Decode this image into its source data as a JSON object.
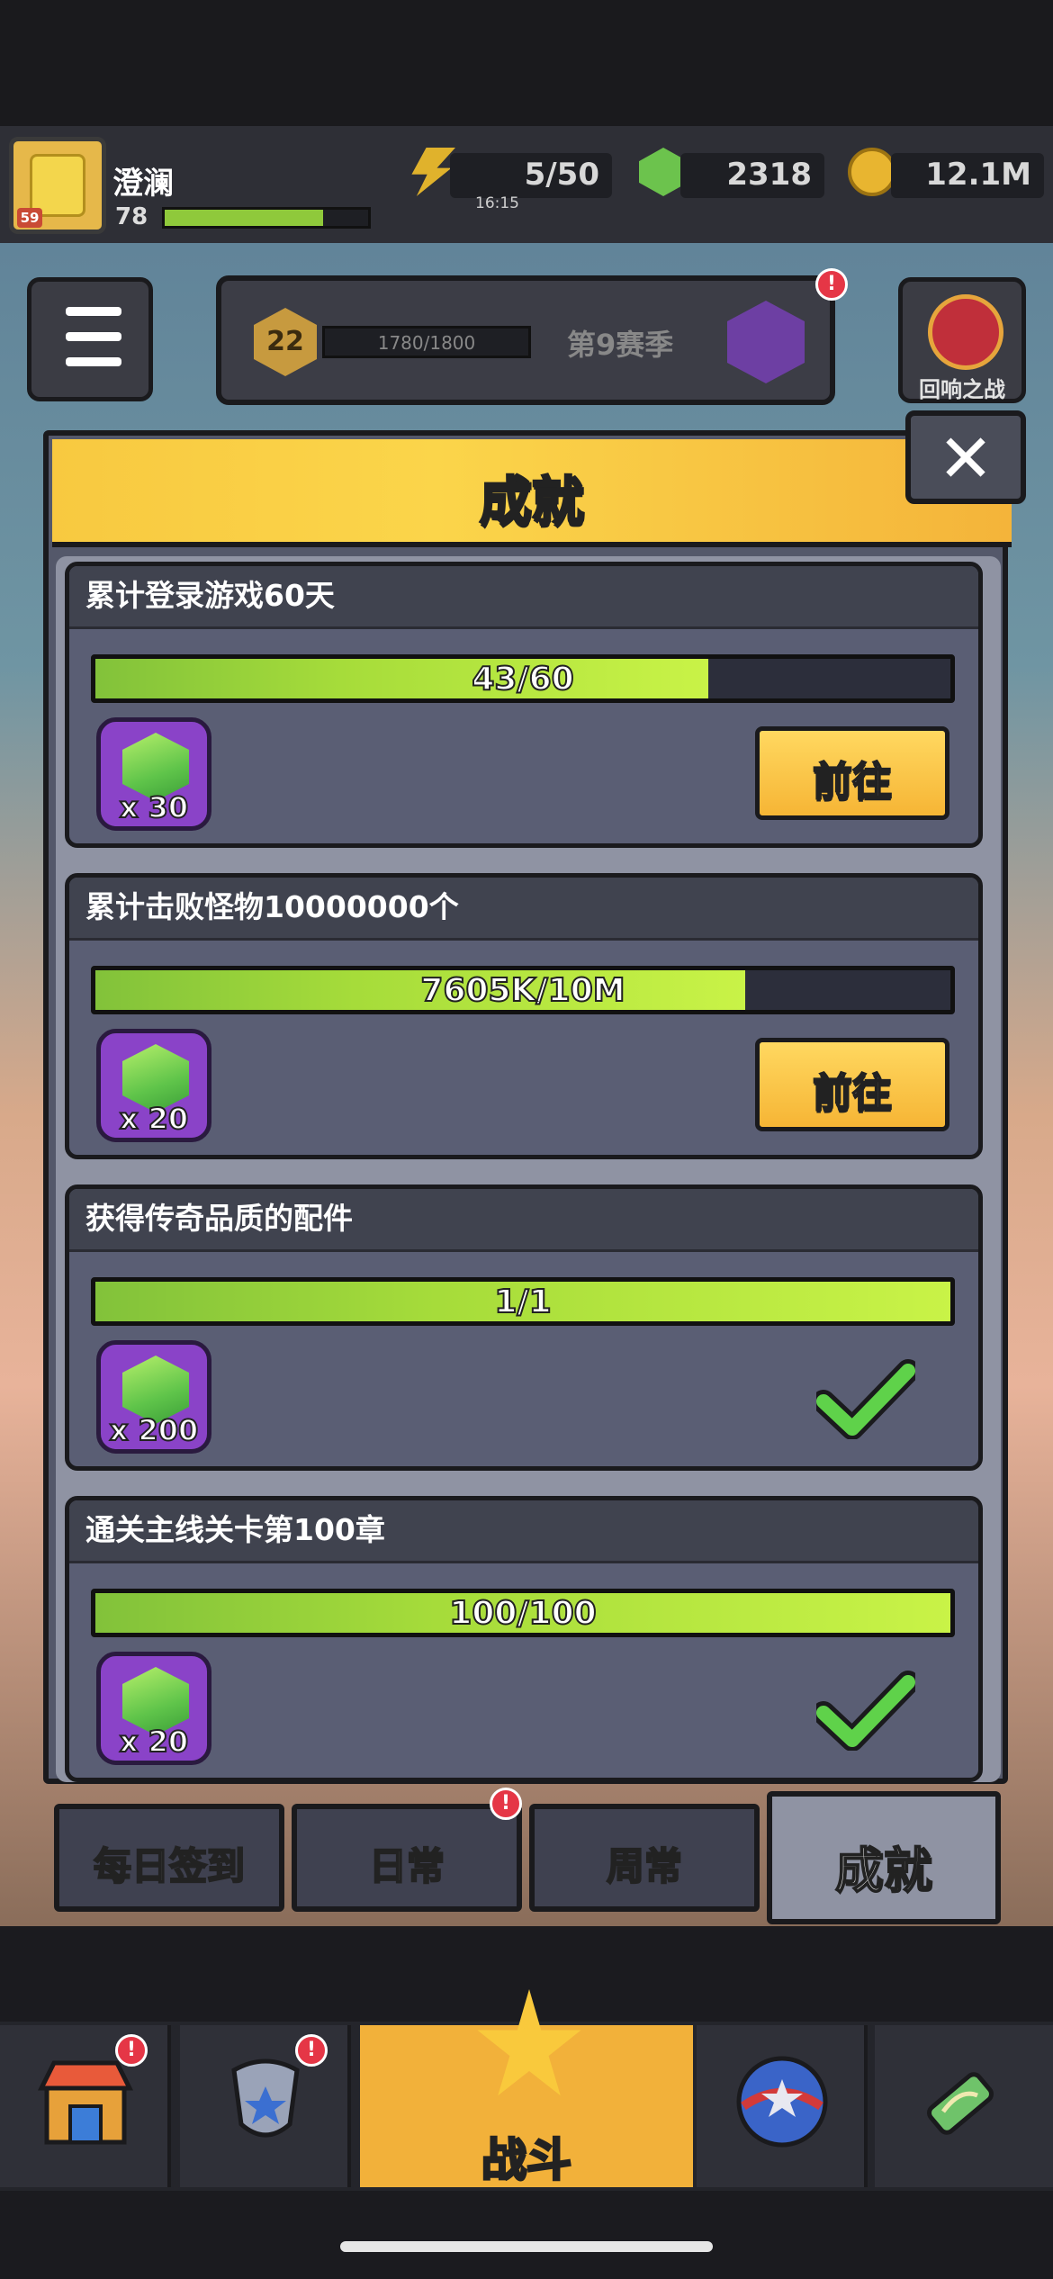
{
  "hud": {
    "player_name": "澄澜",
    "player_level": "78",
    "avatar_level": "59",
    "xp_fill_fraction": 0.78,
    "energy": "5/50",
    "energy_timer": "16:15",
    "gems": "2318",
    "coins": "12.1M"
  },
  "season": {
    "level": "22",
    "progress_text": "1780/1800",
    "label": "第9赛季",
    "alert": "!"
  },
  "echo_battle": {
    "label": "回响之战"
  },
  "modal": {
    "title": "成就",
    "close_glyph": "✕"
  },
  "achievements": [
    {
      "title": "累计登录游戏60天",
      "progress_text": "43/60",
      "progress_fraction": 0.717,
      "reward_qty": "x 30",
      "action": "前往",
      "completed": false
    },
    {
      "title": "累计击败怪物10000000个",
      "progress_text": "7605K/10M",
      "progress_fraction": 0.7605,
      "reward_qty": "x 20",
      "action": "前往",
      "completed": false
    },
    {
      "title": "获得传奇品质的配件",
      "progress_text": "1/1",
      "progress_fraction": 1.0,
      "reward_qty": "x 200",
      "action": "",
      "completed": true
    },
    {
      "title": "通关主线关卡第100章",
      "progress_text": "100/100",
      "progress_fraction": 1.0,
      "reward_qty": "x 20",
      "action": "",
      "completed": true
    }
  ],
  "tabs": [
    {
      "label": "每日签到",
      "active": false,
      "alert": ""
    },
    {
      "label": "日常",
      "active": false,
      "alert": "!"
    },
    {
      "label": "周常",
      "active": false,
      "alert": ""
    },
    {
      "label": "成就",
      "active": true,
      "alert": ""
    }
  ],
  "bottom_nav": {
    "battle_label": "战斗",
    "shop_alert": "!",
    "equip_alert": "!",
    "icons": [
      "shop-icon",
      "equipment-icon",
      "battle-icon",
      "talent-icon",
      "dna-icon"
    ]
  },
  "colors": {
    "header_yellow": "#f8c940",
    "progress_green": "#a6dc3a",
    "reward_purple": "#8a43c8",
    "alert_red": "#e53646",
    "button_orange": "#f6b535"
  }
}
